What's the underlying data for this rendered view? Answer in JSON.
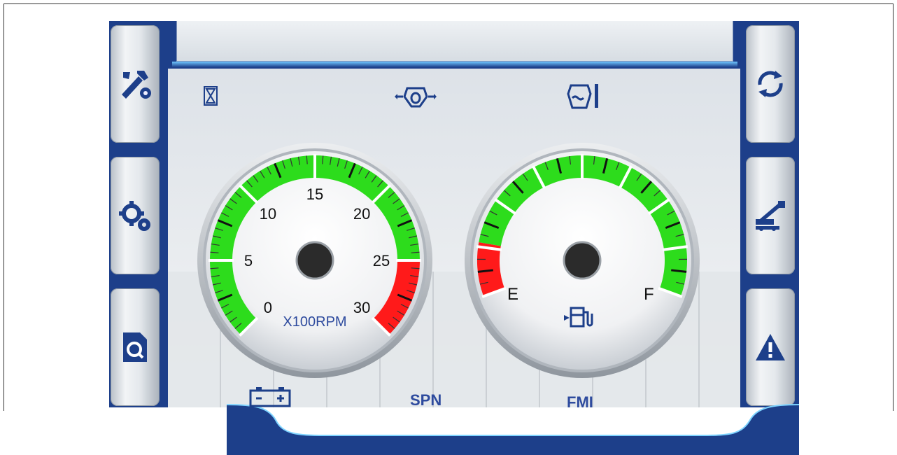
{
  "tachometer": {
    "tick_labels": [
      "0",
      "5",
      "10",
      "15",
      "20",
      "25",
      "30"
    ],
    "unit_label": "X100RPM",
    "max": 30,
    "red_zone_start": 25
  },
  "fuel_gauge": {
    "empty_label": "E",
    "full_label": "F"
  },
  "bottom_bar": {
    "spn_label": "SPN",
    "fmi_label": "FMI"
  },
  "colors": {
    "frame_blue": "#1d3f8a",
    "gauge_green": "#2ddc1c",
    "gauge_red": "#ff1a1a",
    "icon_blue": "#1d3f8a"
  },
  "left_buttons": [
    "wrench-screwdriver-icon",
    "gears-icon",
    "document-search-icon"
  ],
  "right_buttons": [
    "refresh-icon",
    "crane-icon",
    "warning-icon"
  ]
}
